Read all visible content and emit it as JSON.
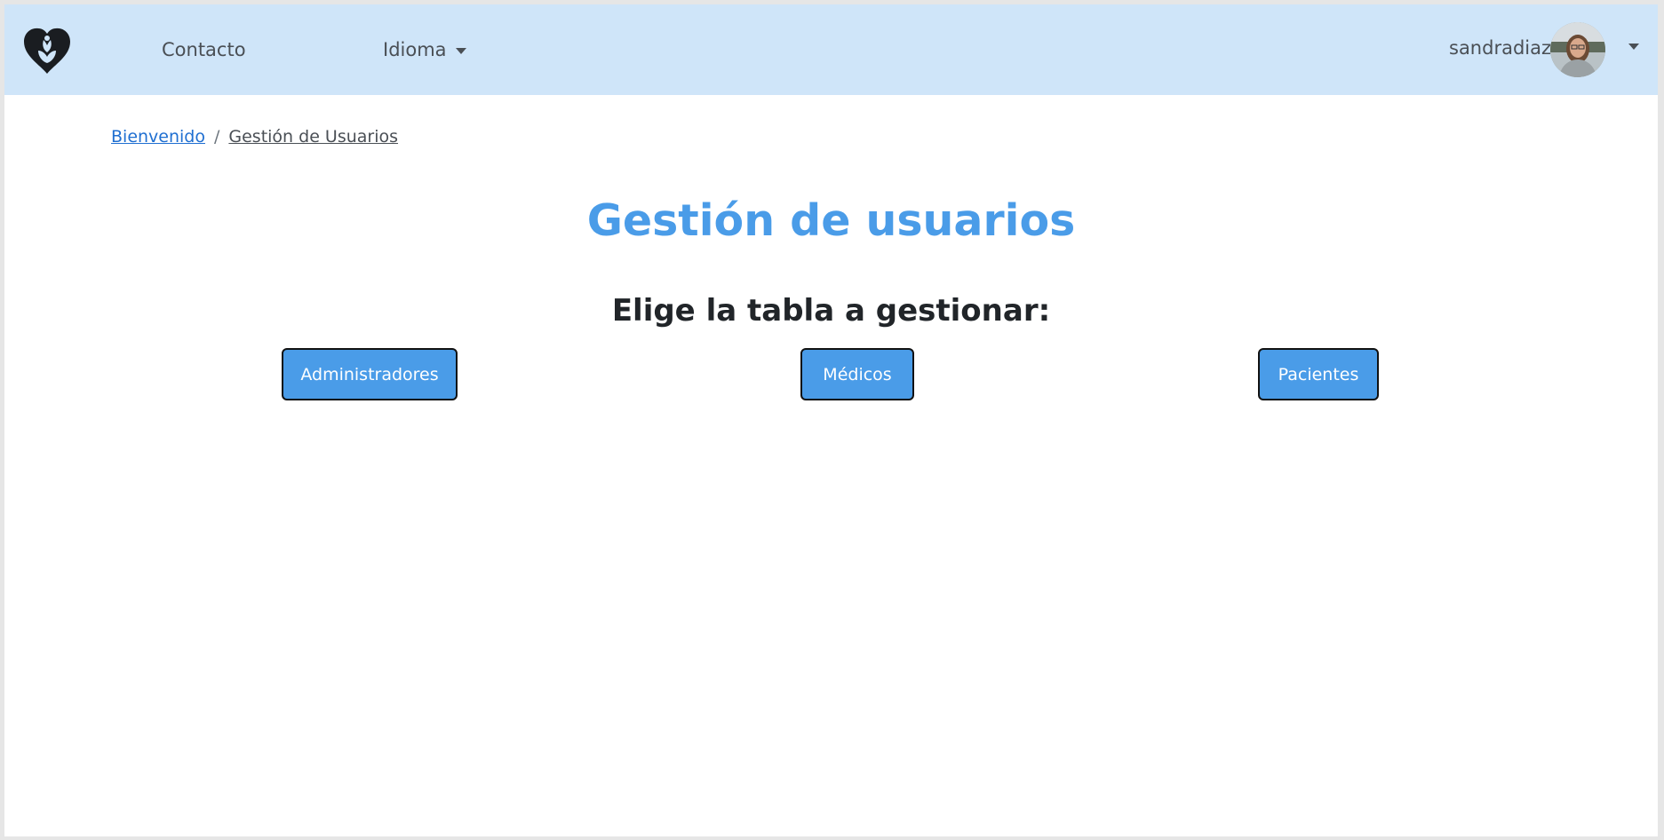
{
  "navbar": {
    "logo_icon": "heart-flower-logo-icon",
    "contact_label": "Contacto",
    "language_label": "Idioma",
    "user_name": "sandradiaz",
    "background_color": "#cfe5f9"
  },
  "breadcrumb": {
    "home_label": "Bienvenido",
    "separator": "/",
    "current_label": "Gestión de Usuarios"
  },
  "main": {
    "title": "Gestión de usuarios",
    "subtitle": "Elige la tabla a gestionar:",
    "buttons": [
      {
        "label": "Administradores"
      },
      {
        "label": "Médicos"
      },
      {
        "label": "Pacientes"
      }
    ],
    "accent_color": "#4a9ce8"
  }
}
